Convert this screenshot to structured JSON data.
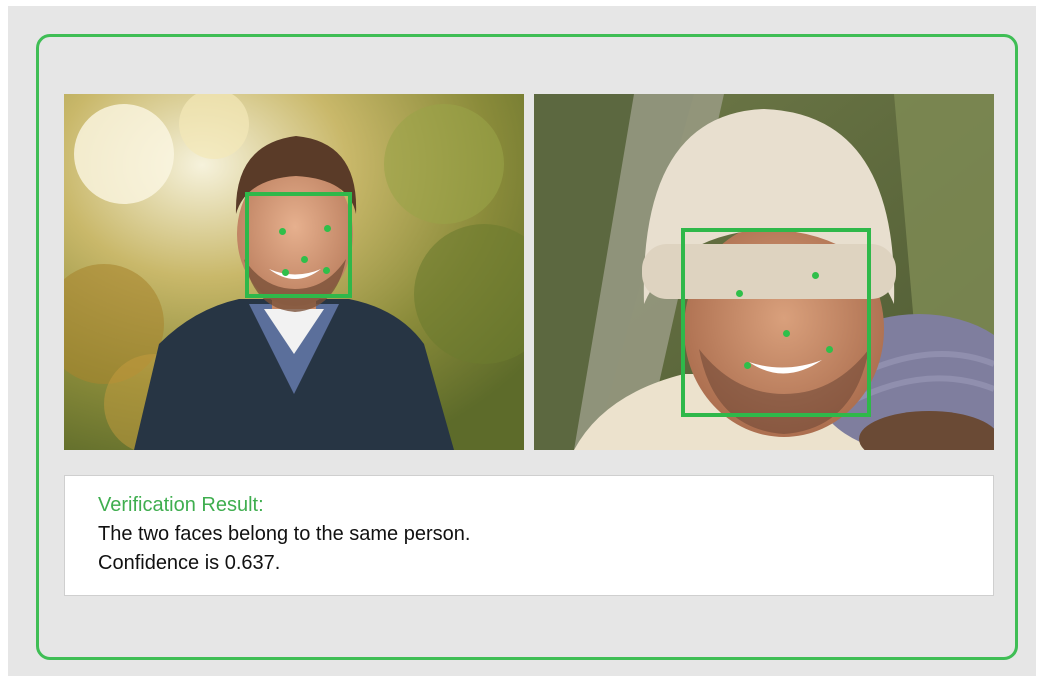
{
  "colors": {
    "accent": "#3fbe55",
    "face_box": "#2fb84a",
    "result_title": "#3fae4f",
    "background": "#e6e6e6"
  },
  "photos": [
    {
      "description_icon": "person-photo",
      "face_detected": true,
      "landmark_count": 5
    },
    {
      "description_icon": "person-photo",
      "face_detected": true,
      "landmark_count": 5
    }
  ],
  "result": {
    "title": "Verification Result:",
    "message": "The two faces belong to the same person.",
    "confidence_text": "Confidence is 0.637."
  }
}
